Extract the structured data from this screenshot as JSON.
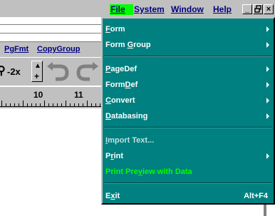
{
  "menubar": {
    "file": "File",
    "system": "System",
    "window": "Window",
    "help": "Help",
    "minimize": "_",
    "restore": "🗗",
    "close": "×"
  },
  "app": {
    "tabs": [
      "PgFmt",
      "CopyGroup"
    ],
    "zoom_label": "-2x",
    "ruler": [
      "10",
      "11"
    ]
  },
  "file_menu": {
    "items": [
      {
        "label": "Form",
        "submenu": true
      },
      {
        "label": "Form Group",
        "submenu": true
      },
      {
        "label": "PageDef",
        "submenu": true
      },
      {
        "label": "FormDef",
        "submenu": true
      },
      {
        "label": "Convert",
        "submenu": true
      },
      {
        "label": "Databasing",
        "submenu": true
      },
      {
        "label": "Import Text...",
        "submenu": false,
        "disabled": true
      },
      {
        "label": "Print",
        "submenu": true
      },
      {
        "label": "Print Preview with Data",
        "submenu": false,
        "highlight": true
      },
      {
        "label": "Exit",
        "accelerator": "Alt+F4"
      }
    ]
  },
  "colors": {
    "menu_bg": "#008080",
    "menu_text": "#ffffff",
    "highlight_text": "#00ff00",
    "title_accent": "#000080"
  }
}
